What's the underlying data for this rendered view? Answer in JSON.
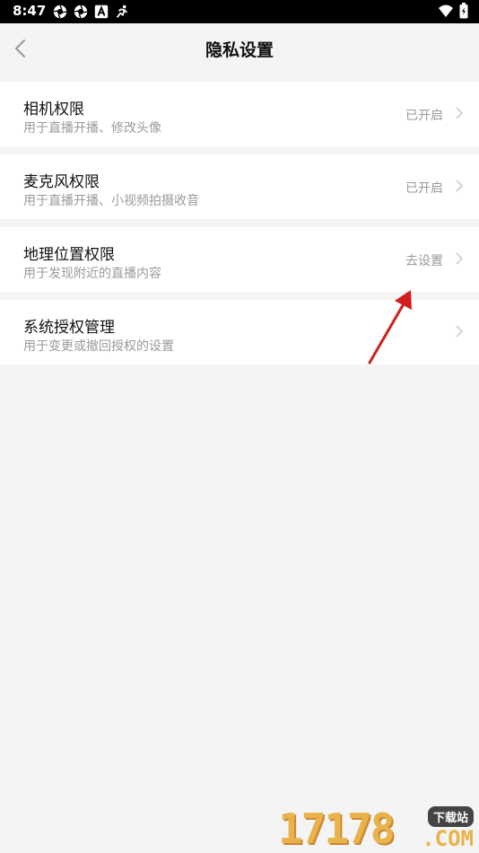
{
  "status_bar": {
    "time": "8:47"
  },
  "header": {
    "title": "隐私设置"
  },
  "settings": [
    {
      "title": "相机权限",
      "subtitle": "用于直播开播、修改头像",
      "status": "已开启"
    },
    {
      "title": "麦克风权限",
      "subtitle": "用于直播开播、小视频拍摄收音",
      "status": "已开启"
    },
    {
      "title": "地理位置权限",
      "subtitle": "用于发现附近的直播内容",
      "status": "去设置"
    },
    {
      "title": "系统授权管理",
      "subtitle": "用于变更或撤回授权的设置",
      "status": ""
    }
  ],
  "colors": {
    "annotation_arrow": "#d21e1e",
    "background": "#f4f4f4",
    "card": "#ffffff"
  },
  "watermark": {
    "digits": "17178",
    "badge": "下载站",
    "domain": ".COM"
  }
}
